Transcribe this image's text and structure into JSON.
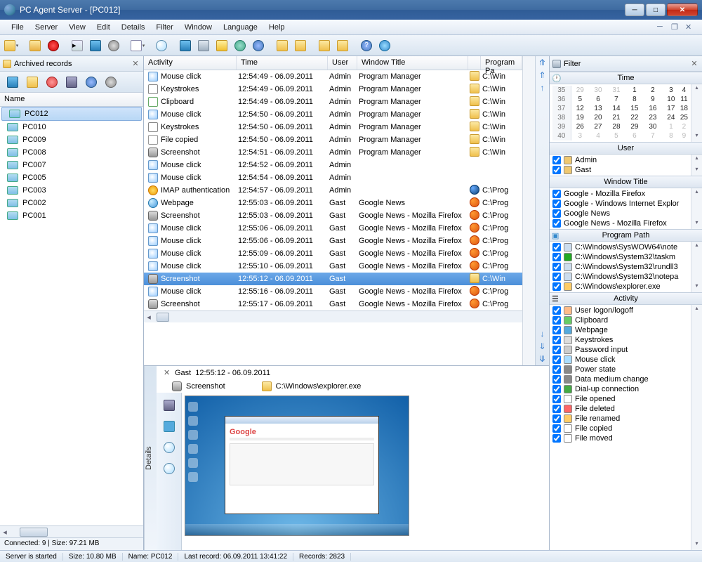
{
  "titlebar": {
    "text": "PC Agent Server - [PC012]"
  },
  "menu": [
    "File",
    "Server",
    "View",
    "Edit",
    "Details",
    "Filter",
    "Window",
    "Language",
    "Help"
  ],
  "leftpanel": {
    "title": "Archived records",
    "colheader": "Name",
    "items": [
      "PC012",
      "PC010",
      "PC009",
      "PC008",
      "PC007",
      "PC005",
      "PC003",
      "PC002",
      "PC001"
    ],
    "selected": 0,
    "status": "Connected: 9 | Size: 97.21 MB"
  },
  "columns": [
    "Activity",
    "Time",
    "User",
    "Window Title",
    "",
    "Program Pa"
  ],
  "rows": [
    {
      "icon": "ai-click",
      "act": "Mouse click",
      "time": "12:54:49 - 06.09.2011",
      "user": "Admin",
      "win": "Program Manager",
      "picon": "pi-folder",
      "prog": "C:\\Win"
    },
    {
      "icon": "ai-keys",
      "act": "Keystrokes",
      "time": "12:54:49 - 06.09.2011",
      "user": "Admin",
      "win": "Program Manager",
      "picon": "pi-folder",
      "prog": "C:\\Win"
    },
    {
      "icon": "ai-clip",
      "act": "Clipboard",
      "time": "12:54:49 - 06.09.2011",
      "user": "Admin",
      "win": "Program Manager",
      "picon": "pi-folder",
      "prog": "C:\\Win"
    },
    {
      "icon": "ai-click",
      "act": "Mouse click",
      "time": "12:54:50 - 06.09.2011",
      "user": "Admin",
      "win": "Program Manager",
      "picon": "pi-folder",
      "prog": "C:\\Win"
    },
    {
      "icon": "ai-keys",
      "act": "Keystrokes",
      "time": "12:54:50 - 06.09.2011",
      "user": "Admin",
      "win": "Program Manager",
      "picon": "pi-folder",
      "prog": "C:\\Win"
    },
    {
      "icon": "ai-file",
      "act": "File copied",
      "time": "12:54:50 - 06.09.2011",
      "user": "Admin",
      "win": "Program Manager",
      "picon": "pi-folder",
      "prog": "C:\\Win"
    },
    {
      "icon": "ai-shot",
      "act": "Screenshot",
      "time": "12:54:51 - 06.09.2011",
      "user": "Admin",
      "win": "Program Manager",
      "picon": "pi-folder",
      "prog": "C:\\Win"
    },
    {
      "icon": "ai-click",
      "act": "Mouse click",
      "time": "12:54:52 - 06.09.2011",
      "user": "Admin",
      "win": "",
      "picon": "",
      "prog": ""
    },
    {
      "icon": "ai-click",
      "act": "Mouse click",
      "time": "12:54:54 - 06.09.2011",
      "user": "Admin",
      "win": "",
      "picon": "",
      "prog": ""
    },
    {
      "icon": "ai-key2",
      "act": "IMAP authentication",
      "time": "12:54:57 - 06.09.2011",
      "user": "Admin",
      "win": "",
      "picon": "pi-tb",
      "prog": "C:\\Prog"
    },
    {
      "icon": "ai-web",
      "act": "Webpage",
      "time": "12:55:03 - 06.09.2011",
      "user": "Gast",
      "win": "Google News",
      "picon": "pi-ff",
      "prog": "C:\\Prog"
    },
    {
      "icon": "ai-shot",
      "act": "Screenshot",
      "time": "12:55:03 - 06.09.2011",
      "user": "Gast",
      "win": "Google News - Mozilla Firefox",
      "picon": "pi-ff",
      "prog": "C:\\Prog"
    },
    {
      "icon": "ai-click",
      "act": "Mouse click",
      "time": "12:55:06 - 06.09.2011",
      "user": "Gast",
      "win": "Google News - Mozilla Firefox",
      "picon": "pi-ff",
      "prog": "C:\\Prog"
    },
    {
      "icon": "ai-click",
      "act": "Mouse click",
      "time": "12:55:06 - 06.09.2011",
      "user": "Gast",
      "win": "Google News - Mozilla Firefox",
      "picon": "pi-ff",
      "prog": "C:\\Prog"
    },
    {
      "icon": "ai-click",
      "act": "Mouse click",
      "time": "12:55:09 - 06.09.2011",
      "user": "Gast",
      "win": "Google News - Mozilla Firefox",
      "picon": "pi-ff",
      "prog": "C:\\Prog"
    },
    {
      "icon": "ai-click",
      "act": "Mouse click",
      "time": "12:55:10 - 06.09.2011",
      "user": "Gast",
      "win": "Google News - Mozilla Firefox",
      "picon": "pi-ff",
      "prog": "C:\\Prog"
    },
    {
      "icon": "ai-shot",
      "act": "Screenshot",
      "time": "12:55:12 - 06.09.2011",
      "user": "Gast",
      "win": "",
      "picon": "pi-folder",
      "prog": "C:\\Win",
      "selected": true
    },
    {
      "icon": "ai-click",
      "act": "Mouse click",
      "time": "12:55:16 - 06.09.2011",
      "user": "Gast",
      "win": "Google News - Mozilla Firefox",
      "picon": "pi-ff",
      "prog": "C:\\Prog"
    },
    {
      "icon": "ai-shot",
      "act": "Screenshot",
      "time": "12:55:17 - 06.09.2011",
      "user": "Gast",
      "win": "Google News - Mozilla Firefox",
      "picon": "pi-ff",
      "prog": "C:\\Prog"
    }
  ],
  "details": {
    "label": "Details",
    "user": "Gast",
    "timestamp": "12:55:12 - 06.09.2011",
    "activity": "Screenshot",
    "path": "C:\\Windows\\explorer.exe"
  },
  "filter": {
    "title": "Filter",
    "time_label": "Time",
    "calendar": {
      "weeks": [
        35,
        36,
        37,
        38,
        39,
        40
      ],
      "days": [
        [
          "g29",
          "g30",
          "g31",
          "1",
          "2",
          "3",
          "4"
        ],
        [
          "5",
          "6",
          "7",
          "8",
          "9",
          "10",
          "11"
        ],
        [
          "12",
          "13",
          "14",
          "15",
          "16",
          "17",
          "18"
        ],
        [
          "19",
          "20",
          "21",
          "22",
          "23",
          "24",
          "25"
        ],
        [
          "26",
          "27",
          "28",
          "29",
          "30",
          "g1",
          "g2"
        ],
        [
          "g3",
          "g4",
          "g5",
          "g6",
          "g7",
          "g8",
          "g9"
        ]
      ]
    },
    "user_label": "User",
    "users": [
      "Admin",
      "Gast"
    ],
    "window_label": "Window Title",
    "windows": [
      "Google - Mozilla Firefox",
      "Google - Windows Internet Explor",
      "Google News",
      "Google News - Mozilla Firefox"
    ],
    "program_label": "Program Path",
    "programs": [
      "C:\\Windows\\SysWOW64\\note",
      "C:\\Windows\\System32\\taskm",
      "C:\\Windows\\System32\\rundll3",
      "C:\\Windows\\System32\\notepa",
      "C:\\Windows\\explorer.exe"
    ],
    "activity_label": "Activity",
    "activities": [
      "User logon/logoff",
      "Clipboard",
      "Webpage",
      "Keystrokes",
      "Password input",
      "Mouse click",
      "Power state",
      "Data medium change",
      "Dial-up connection",
      "File opened",
      "File deleted",
      "File renamed",
      "File copied",
      "File moved"
    ]
  },
  "statusbar": {
    "s1": "Server is started",
    "s2": "Size: 10.80 MB",
    "s3": "Name: PC012",
    "s4": "Last record: 06.09.2011 13:41:22",
    "s5": "Records: 2823"
  }
}
